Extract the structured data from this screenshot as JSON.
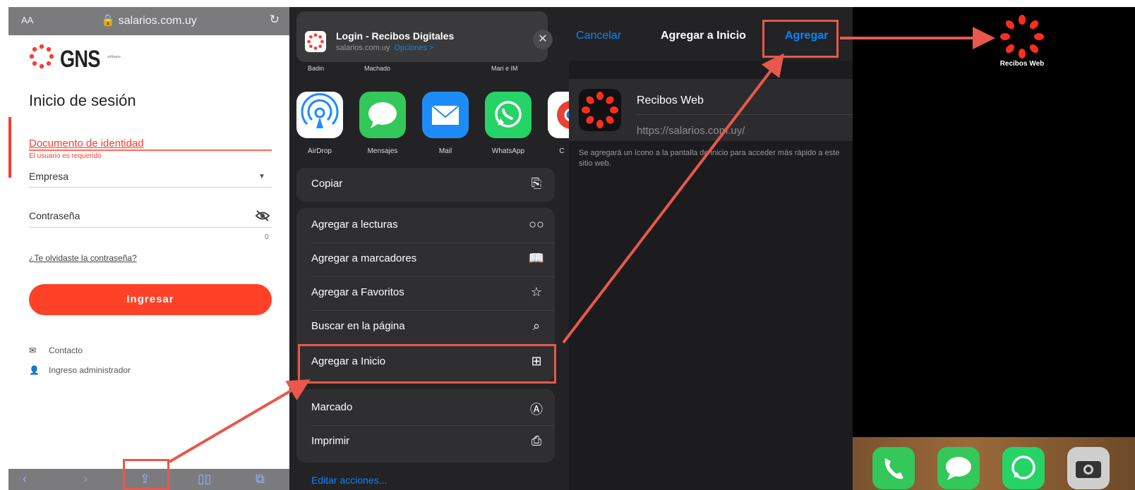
{
  "safari": {
    "aa": "AA",
    "url": "salarios.com.uy",
    "brand": "GNS",
    "brand_sub": "software",
    "title": "Inicio de sesión",
    "doc_label": "Documento de identidad",
    "doc_error": "El usuario es requerido",
    "empresa_label": "Empresa",
    "password_label": "Contraseña",
    "char_count": "0",
    "forgot": "¿Te olvidaste la contraseña?",
    "login_button": "Ingresar",
    "contact": "Contacto",
    "admin": "Ingreso administrador"
  },
  "share": {
    "page_title": "Login - Recibos Digitales",
    "page_url": "salarios.com.uy",
    "options": "Opciones >",
    "people": [
      "Badin",
      "Machado",
      "Mari e IM"
    ],
    "apps": [
      {
        "name": "AirDrop",
        "color": "#ffffff"
      },
      {
        "name": "Mensajes",
        "color": "#34c759"
      },
      {
        "name": "Mail",
        "color": "#1d8cf8"
      },
      {
        "name": "WhatsApp",
        "color": "#25d366"
      },
      {
        "name": "C",
        "color": "#ffffff"
      }
    ],
    "copy": "Copiar",
    "actions": [
      {
        "label": "Agregar a lecturas",
        "icon": "glasses-icon"
      },
      {
        "label": "Agregar a marcadores",
        "icon": "book-icon"
      },
      {
        "label": "Agregar a Favoritos",
        "icon": "star-icon"
      },
      {
        "label": "Buscar en la página",
        "icon": "search-icon"
      },
      {
        "label": "Agregar a Inicio",
        "icon": "add-square-icon"
      }
    ],
    "extra_actions": [
      {
        "label": "Marcado",
        "icon": "markup-icon"
      },
      {
        "label": "Imprimir",
        "icon": "printer-icon"
      }
    ],
    "edit": "Editar acciones..."
  },
  "add_home": {
    "cancel": "Cancelar",
    "title": "Agregar a Inicio",
    "add": "Agregar",
    "app_name": "Recibos Web",
    "url": "https://salarios.com.uy/",
    "note": "Se agregará un ícono a la pantalla de inicio para acceder más rápido a este sitio web."
  },
  "home": {
    "icon_label": "Recibos Web",
    "dock": [
      {
        "name": "phone-icon",
        "color": "#34c759"
      },
      {
        "name": "messages-icon",
        "color": "#34c759"
      },
      {
        "name": "whatsapp-icon",
        "color": "#25d366"
      },
      {
        "name": "camera-icon",
        "color": "#cfcfcf"
      }
    ]
  },
  "colors": {
    "accent": "#ff3b30",
    "annotation": "#e8584c",
    "ios_blue": "#0a84ff"
  }
}
